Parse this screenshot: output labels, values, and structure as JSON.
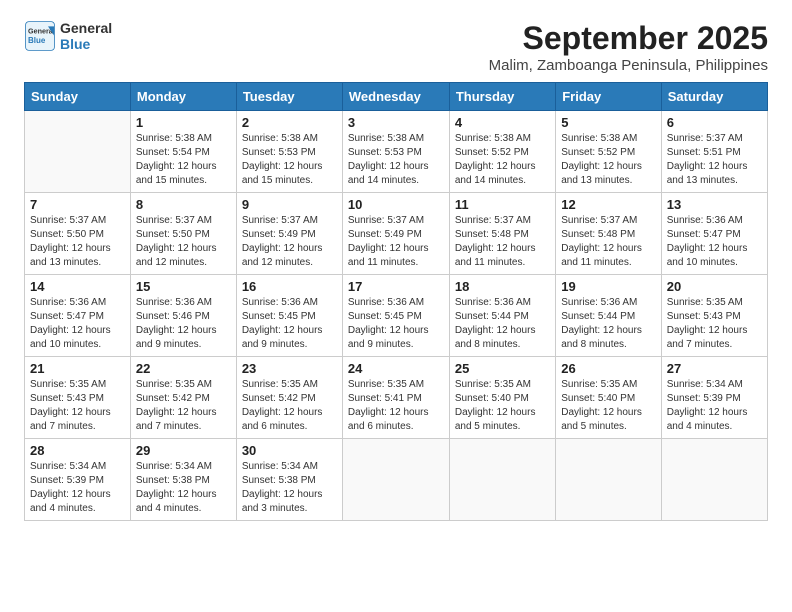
{
  "logo": {
    "line1": "General",
    "line2": "Blue"
  },
  "title": "September 2025",
  "subtitle": "Malim, Zamboanga Peninsula, Philippines",
  "weekdays": [
    "Sunday",
    "Monday",
    "Tuesday",
    "Wednesday",
    "Thursday",
    "Friday",
    "Saturday"
  ],
  "weeks": [
    [
      {
        "day": "",
        "info": ""
      },
      {
        "day": "1",
        "info": "Sunrise: 5:38 AM\nSunset: 5:54 PM\nDaylight: 12 hours\nand 15 minutes."
      },
      {
        "day": "2",
        "info": "Sunrise: 5:38 AM\nSunset: 5:53 PM\nDaylight: 12 hours\nand 15 minutes."
      },
      {
        "day": "3",
        "info": "Sunrise: 5:38 AM\nSunset: 5:53 PM\nDaylight: 12 hours\nand 14 minutes."
      },
      {
        "day": "4",
        "info": "Sunrise: 5:38 AM\nSunset: 5:52 PM\nDaylight: 12 hours\nand 14 minutes."
      },
      {
        "day": "5",
        "info": "Sunrise: 5:38 AM\nSunset: 5:52 PM\nDaylight: 12 hours\nand 13 minutes."
      },
      {
        "day": "6",
        "info": "Sunrise: 5:37 AM\nSunset: 5:51 PM\nDaylight: 12 hours\nand 13 minutes."
      }
    ],
    [
      {
        "day": "7",
        "info": "Sunrise: 5:37 AM\nSunset: 5:50 PM\nDaylight: 12 hours\nand 13 minutes."
      },
      {
        "day": "8",
        "info": "Sunrise: 5:37 AM\nSunset: 5:50 PM\nDaylight: 12 hours\nand 12 minutes."
      },
      {
        "day": "9",
        "info": "Sunrise: 5:37 AM\nSunset: 5:49 PM\nDaylight: 12 hours\nand 12 minutes."
      },
      {
        "day": "10",
        "info": "Sunrise: 5:37 AM\nSunset: 5:49 PM\nDaylight: 12 hours\nand 11 minutes."
      },
      {
        "day": "11",
        "info": "Sunrise: 5:37 AM\nSunset: 5:48 PM\nDaylight: 12 hours\nand 11 minutes."
      },
      {
        "day": "12",
        "info": "Sunrise: 5:37 AM\nSunset: 5:48 PM\nDaylight: 12 hours\nand 11 minutes."
      },
      {
        "day": "13",
        "info": "Sunrise: 5:36 AM\nSunset: 5:47 PM\nDaylight: 12 hours\nand 10 minutes."
      }
    ],
    [
      {
        "day": "14",
        "info": "Sunrise: 5:36 AM\nSunset: 5:47 PM\nDaylight: 12 hours\nand 10 minutes."
      },
      {
        "day": "15",
        "info": "Sunrise: 5:36 AM\nSunset: 5:46 PM\nDaylight: 12 hours\nand 9 minutes."
      },
      {
        "day": "16",
        "info": "Sunrise: 5:36 AM\nSunset: 5:45 PM\nDaylight: 12 hours\nand 9 minutes."
      },
      {
        "day": "17",
        "info": "Sunrise: 5:36 AM\nSunset: 5:45 PM\nDaylight: 12 hours\nand 9 minutes."
      },
      {
        "day": "18",
        "info": "Sunrise: 5:36 AM\nSunset: 5:44 PM\nDaylight: 12 hours\nand 8 minutes."
      },
      {
        "day": "19",
        "info": "Sunrise: 5:36 AM\nSunset: 5:44 PM\nDaylight: 12 hours\nand 8 minutes."
      },
      {
        "day": "20",
        "info": "Sunrise: 5:35 AM\nSunset: 5:43 PM\nDaylight: 12 hours\nand 7 minutes."
      }
    ],
    [
      {
        "day": "21",
        "info": "Sunrise: 5:35 AM\nSunset: 5:43 PM\nDaylight: 12 hours\nand 7 minutes."
      },
      {
        "day": "22",
        "info": "Sunrise: 5:35 AM\nSunset: 5:42 PM\nDaylight: 12 hours\nand 7 minutes."
      },
      {
        "day": "23",
        "info": "Sunrise: 5:35 AM\nSunset: 5:42 PM\nDaylight: 12 hours\nand 6 minutes."
      },
      {
        "day": "24",
        "info": "Sunrise: 5:35 AM\nSunset: 5:41 PM\nDaylight: 12 hours\nand 6 minutes."
      },
      {
        "day": "25",
        "info": "Sunrise: 5:35 AM\nSunset: 5:40 PM\nDaylight: 12 hours\nand 5 minutes."
      },
      {
        "day": "26",
        "info": "Sunrise: 5:35 AM\nSunset: 5:40 PM\nDaylight: 12 hours\nand 5 minutes."
      },
      {
        "day": "27",
        "info": "Sunrise: 5:34 AM\nSunset: 5:39 PM\nDaylight: 12 hours\nand 4 minutes."
      }
    ],
    [
      {
        "day": "28",
        "info": "Sunrise: 5:34 AM\nSunset: 5:39 PM\nDaylight: 12 hours\nand 4 minutes."
      },
      {
        "day": "29",
        "info": "Sunrise: 5:34 AM\nSunset: 5:38 PM\nDaylight: 12 hours\nand 4 minutes."
      },
      {
        "day": "30",
        "info": "Sunrise: 5:34 AM\nSunset: 5:38 PM\nDaylight: 12 hours\nand 3 minutes."
      },
      {
        "day": "",
        "info": ""
      },
      {
        "day": "",
        "info": ""
      },
      {
        "day": "",
        "info": ""
      },
      {
        "day": "",
        "info": ""
      }
    ]
  ]
}
